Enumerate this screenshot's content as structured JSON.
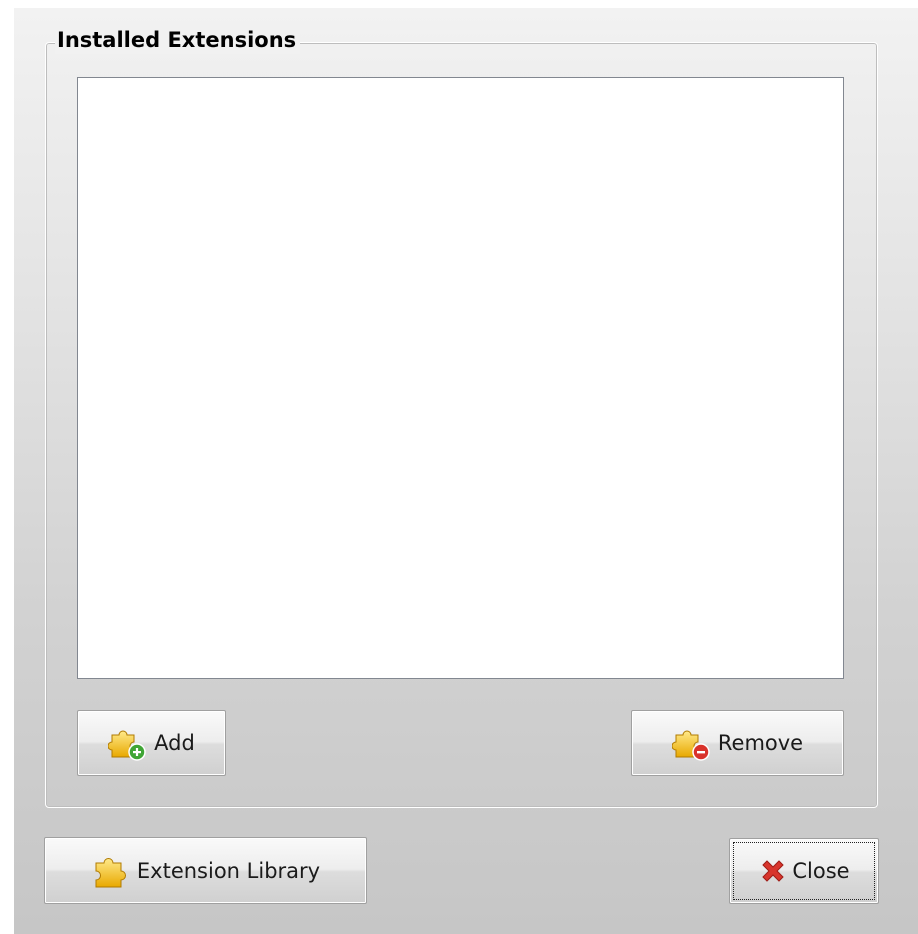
{
  "group": {
    "title": "Installed Extensions"
  },
  "list": {
    "items": []
  },
  "buttons": {
    "add_label": "Add",
    "remove_label": "Remove",
    "library_label": "Extension Library",
    "close_label": "Close"
  },
  "icons": {
    "add": "puzzle-add-icon",
    "remove": "puzzle-remove-icon",
    "library": "puzzle-icon",
    "close": "red-x-icon"
  },
  "colors": {
    "puzzle": "#f5c518",
    "add_badge": "#3fa535",
    "remove_badge": "#d9322b",
    "close_x": "#d8352c"
  }
}
